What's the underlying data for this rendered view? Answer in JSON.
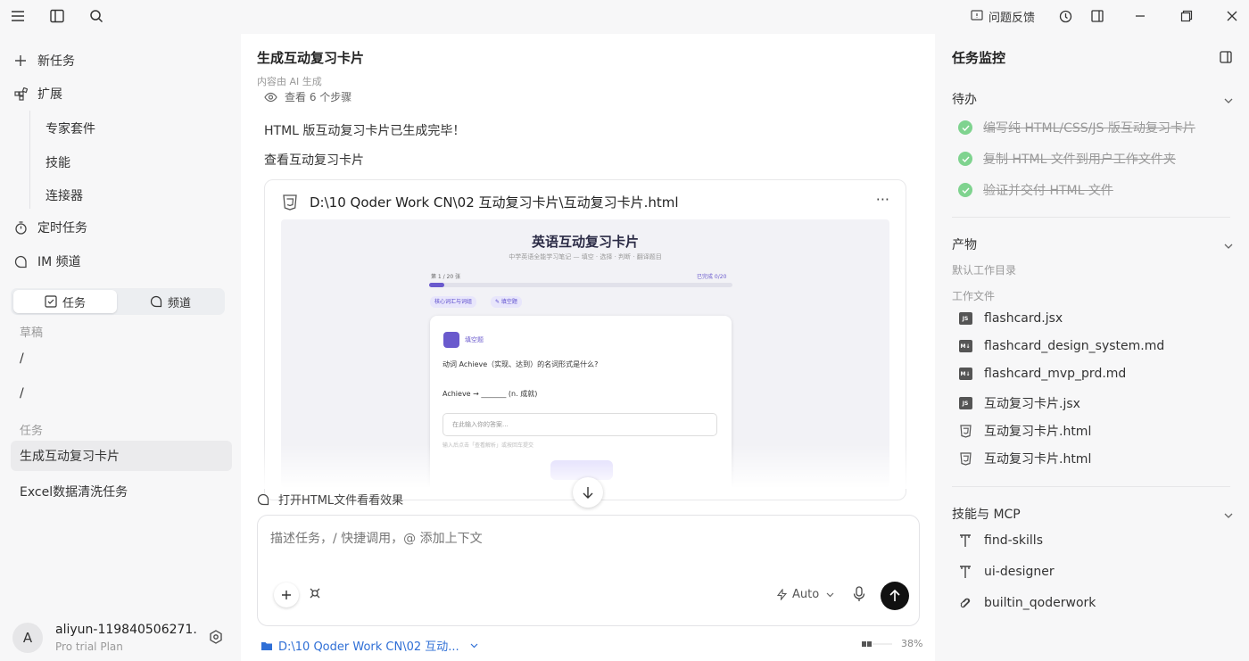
{
  "titlebar": {
    "feedback_label": "问题反馈"
  },
  "sidebar": {
    "new_task": "新任务",
    "extensions": "扩展",
    "sub_items": [
      "专家套件",
      "技能",
      "连接器"
    ],
    "scheduled": "定时任务",
    "im_channel": "IM 频道",
    "tabs": {
      "tasks": "任务",
      "channels": "频道"
    },
    "drafts_label": "草稿",
    "drafts": [
      "/",
      "/"
    ],
    "tasks_label": "任务",
    "tasks": [
      "生成互动复习卡片",
      "Excel数据清洗任务"
    ],
    "selected_task": "生成互动复习卡片"
  },
  "user": {
    "initial": "A",
    "name": "aliyun-119840506271...",
    "plan": "Pro trial Plan"
  },
  "main": {
    "title": "生成互动复习卡片",
    "ai_note": "内容由 AI 生成",
    "steps_label": "查看 6 个步骤",
    "message1": "HTML 版互动复习卡片已生成完毕！",
    "message2": "查看互动复习卡片",
    "file_path": "D:\\10 Qoder Work CN\\02 互动复习卡片\\互动复习卡片.html",
    "more": "···",
    "suggestion": "打开HTML文件看看效果",
    "composer_placeholder": "描述任务，/ 快捷调用，@ 添加上下文",
    "mode_label": "Auto",
    "workspace_path": "D:\\10 Qoder Work CN\\02 互动...",
    "context_percent": "38%"
  },
  "preview": {
    "title": "英语互动复习卡片",
    "subtitle": "中学英语全能学习笔记 — 填空 · 选择 · 判断 · 翻译题目",
    "progress_label": "第 1 / 20 张",
    "done_label": "已完成 0/20",
    "progress_fraction": 0.05,
    "tags": [
      "核心词汇与词组",
      "✎ 填空题"
    ],
    "card_type": "填空题",
    "question": "动词 Achieve（实现、达到）的名词形式是什么?",
    "example": "Achieve → _______ (n. 成就)",
    "input_placeholder": "在此输入你的答案...",
    "hint": "输入后点击「查看解析」或按回车提交"
  },
  "right": {
    "title": "任务监控",
    "todo_label": "待办",
    "todos": [
      "编写纯 HTML/CSS/JS 版互动复习卡片",
      "复制 HTML 文件到用户工作文件夹",
      "验证并交付 HTML 文件"
    ],
    "output_label": "产物",
    "default_dir": "默认工作目录",
    "work_files_label": "工作文件",
    "files": [
      {
        "name": "flashcard.jsx",
        "type": "JS"
      },
      {
        "name": "flashcard_design_system.md",
        "type": "MD"
      },
      {
        "name": "flashcard_mvp_prd.md",
        "type": "MD"
      },
      {
        "name": "互动复习卡片.jsx",
        "type": "JS"
      },
      {
        "name": "互动复习卡片.html",
        "type": "HTML"
      },
      {
        "name": "互动复习卡片.html",
        "type": "HTML"
      }
    ],
    "skills_label": "技能与 MCP",
    "skills": [
      "find-skills",
      "ui-designer",
      "builtin_qoderwork"
    ]
  },
  "colors": {
    "accent": "#6a5acd",
    "check": "#7fd38f",
    "link": "#2f6fd6"
  }
}
